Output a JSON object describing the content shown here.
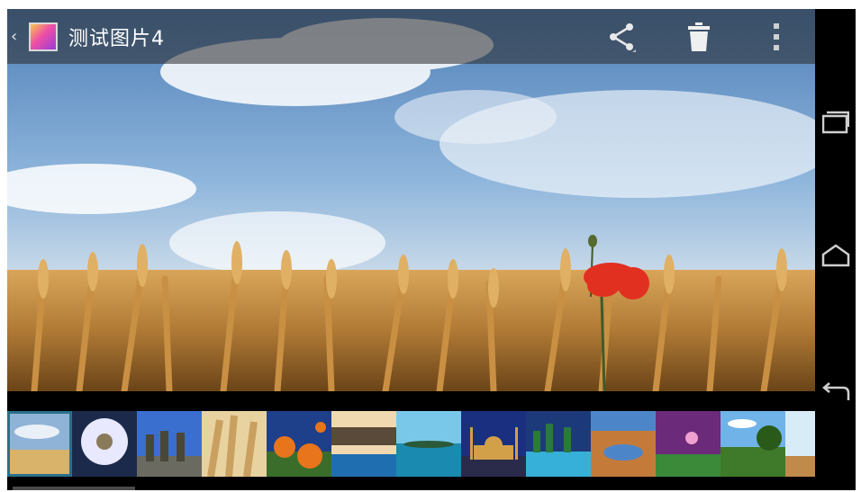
{
  "app": {
    "up_caret": "‹",
    "title": "测试图片4"
  },
  "actions": [
    {
      "name": "share",
      "icon": "share-icon"
    },
    {
      "name": "delete",
      "icon": "trash-icon"
    },
    {
      "name": "overflow",
      "icon": "more-vertical-icon"
    }
  ],
  "nav": {
    "recents_icon": "recent-apps-icon",
    "home_icon": "home-icon",
    "back_icon": "back-icon"
  },
  "photo": {
    "subject": "wheat-field-with-poppy-icon"
  },
  "filmstrip": {
    "selected_index": 0,
    "thumbnails": [
      {
        "icon": "wheat-sky-thumbnail-icon",
        "colors": [
          "#8fb3d6",
          "#d9b36a"
        ]
      },
      {
        "icon": "white-flower-thumbnail-icon",
        "colors": [
          "#1b2a4a",
          "#e8e8ff"
        ]
      },
      {
        "icon": "stone-statues-thumbnail-icon",
        "colors": [
          "#3a6fd0",
          "#6b6a60"
        ]
      },
      {
        "icon": "wheat-closeup-thumbnail-icon",
        "colors": [
          "#c9a060",
          "#e8d2a0"
        ]
      },
      {
        "icon": "orange-poppies-thumbnail-icon",
        "colors": [
          "#1e3f8a",
          "#e8741c"
        ]
      },
      {
        "icon": "resort-pool-thumbnail-icon",
        "colors": [
          "#f0d8b0",
          "#1f6fb0"
        ]
      },
      {
        "icon": "tropical-sea-thumbnail-icon",
        "colors": [
          "#79c8ea",
          "#1a8ab0"
        ]
      },
      {
        "icon": "mosque-night-thumbnail-icon",
        "colors": [
          "#1a2f80",
          "#d3a04a"
        ]
      },
      {
        "icon": "city-lights-thumbnail-icon",
        "colors": [
          "#1c3a7a",
          "#36b0d8"
        ]
      },
      {
        "icon": "desert-lake-thumbnail-icon",
        "colors": [
          "#4d86c8",
          "#c47b3a"
        ]
      },
      {
        "icon": "purple-sunset-thumbnail-icon",
        "colors": [
          "#6b2a7a",
          "#3a8a3a"
        ]
      },
      {
        "icon": "coast-tree-thumbnail-icon",
        "colors": [
          "#6fb3e8",
          "#3e7a2a"
        ]
      },
      {
        "icon": "bright-sky-thumbnail-icon",
        "colors": [
          "#d8ecf8",
          "#c08a4a"
        ]
      }
    ]
  }
}
